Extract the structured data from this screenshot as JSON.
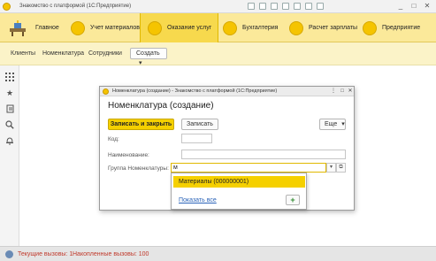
{
  "window": {
    "title": "Знакомство с платформой  (1С:Предприятие)"
  },
  "sections": [
    {
      "label": "Главное"
    },
    {
      "label": "Учет материалов"
    },
    {
      "label": "Оказание услуг"
    },
    {
      "label": "Бухгалтерия"
    },
    {
      "label": "Расчет зарплаты"
    },
    {
      "label": "Предприятие"
    }
  ],
  "nav": {
    "links": [
      "Клиенты",
      "Номенклатура",
      "Сотрудники"
    ],
    "create_label": "Создать",
    "create_arrow": "▾"
  },
  "dialog": {
    "title": "Номенклатура (создание) - Знакомство с платформой  (1С:Предприятие)",
    "heading": "Номенклатура (создание)",
    "save_close_label": "Записать и закрыть",
    "save_label": "Записать",
    "more_label": "Еще",
    "more_arrow": "▾",
    "fields": {
      "code_label": "Код:",
      "code_value": "",
      "name_label": "Наименование:",
      "name_value": "",
      "group_label": "Группа Номенклатуры:",
      "group_value": "м"
    }
  },
  "dropdown": {
    "item": "Материалы (000000001)",
    "show_all": "Показать все",
    "add_symbol": "+"
  },
  "status": {
    "current_calls": "Текущие вызовы: 1",
    "accumulated_calls": "Накопленные вызовы: 100"
  },
  "icons": {
    "app_logo": "1c-logo-icon",
    "home": "home-desk-icon",
    "apps_grid": "grid-icon",
    "favorites": "star-icon",
    "history": "history-icon",
    "search": "search-icon",
    "notifications": "bell-icon"
  },
  "colors": {
    "sections_bg": "#fbe99a",
    "accent": "#f5d000",
    "status_text": "#c0392b",
    "link": "#2a63b8"
  }
}
